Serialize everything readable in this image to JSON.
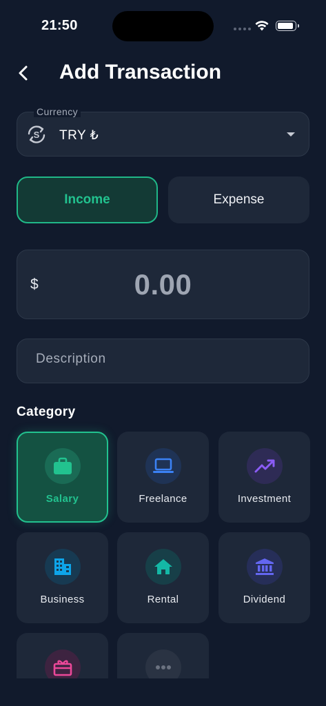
{
  "status": {
    "time": "21:50"
  },
  "header": {
    "title": "Add Transaction"
  },
  "currency": {
    "label": "Currency",
    "value": "TRY ₺"
  },
  "type_toggle": {
    "income": "Income",
    "expense": "Expense",
    "selected": "income"
  },
  "amount": {
    "symbol": "$",
    "value": "0.00"
  },
  "description": {
    "placeholder": "Description"
  },
  "category": {
    "title": "Category",
    "items": [
      {
        "label": "Salary",
        "icon": "briefcase-icon",
        "color": "#22c28f",
        "selected": true
      },
      {
        "label": "Freelance",
        "icon": "laptop-icon",
        "color": "#3b82f6"
      },
      {
        "label": "Investment",
        "icon": "trending-up-icon",
        "color": "#8b5cf6"
      },
      {
        "label": "Business",
        "icon": "building-icon",
        "color": "#0ea5e9"
      },
      {
        "label": "Rental",
        "icon": "home-icon",
        "color": "#14b8a6"
      },
      {
        "label": "Dividend",
        "icon": "bank-icon",
        "color": "#6366f1"
      },
      {
        "label": "",
        "icon": "gift-icon",
        "color": "#ec4899"
      },
      {
        "label": "",
        "icon": "more-icon",
        "color": "#6b7280"
      }
    ]
  }
}
